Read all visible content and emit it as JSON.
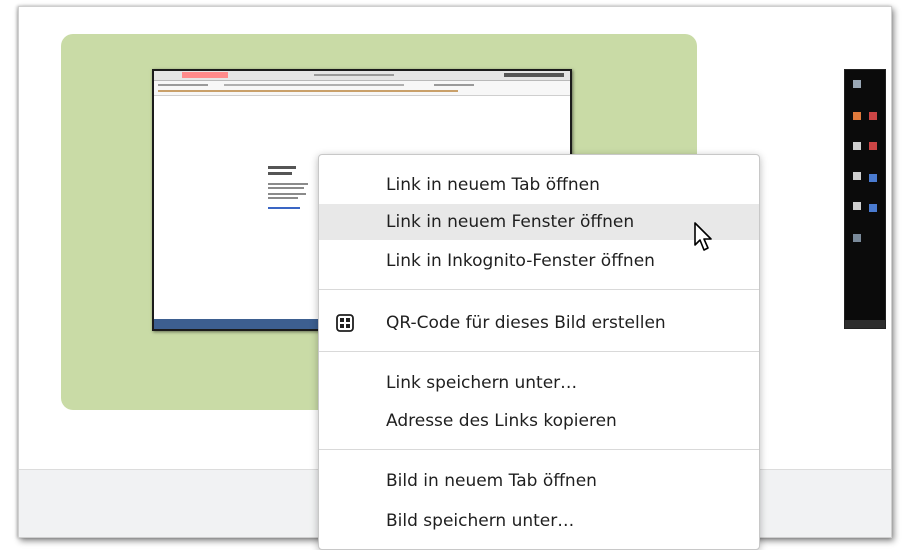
{
  "context_menu": {
    "items": [
      {
        "label": "Link in neuem Tab öffnen"
      },
      {
        "label": "Link in neuem Fenster öffnen"
      },
      {
        "label": "Link in Inkognito-Fenster öffnen"
      },
      {
        "label": "QR-Code für dieses Bild erstellen",
        "icon": "qr-code-icon"
      },
      {
        "label": "Link speichern unter…"
      },
      {
        "label": "Adresse des Links kopieren"
      },
      {
        "label": "Bild in neuem Tab öffnen"
      },
      {
        "label": "Bild speichern unter…"
      }
    ],
    "hovered_item": "Link in neuem Fenster öffnen"
  },
  "colors": {
    "card_background": "#c9dba6",
    "menu_hover": "#e8e8e8",
    "footer_band": "#f1f2f3"
  }
}
